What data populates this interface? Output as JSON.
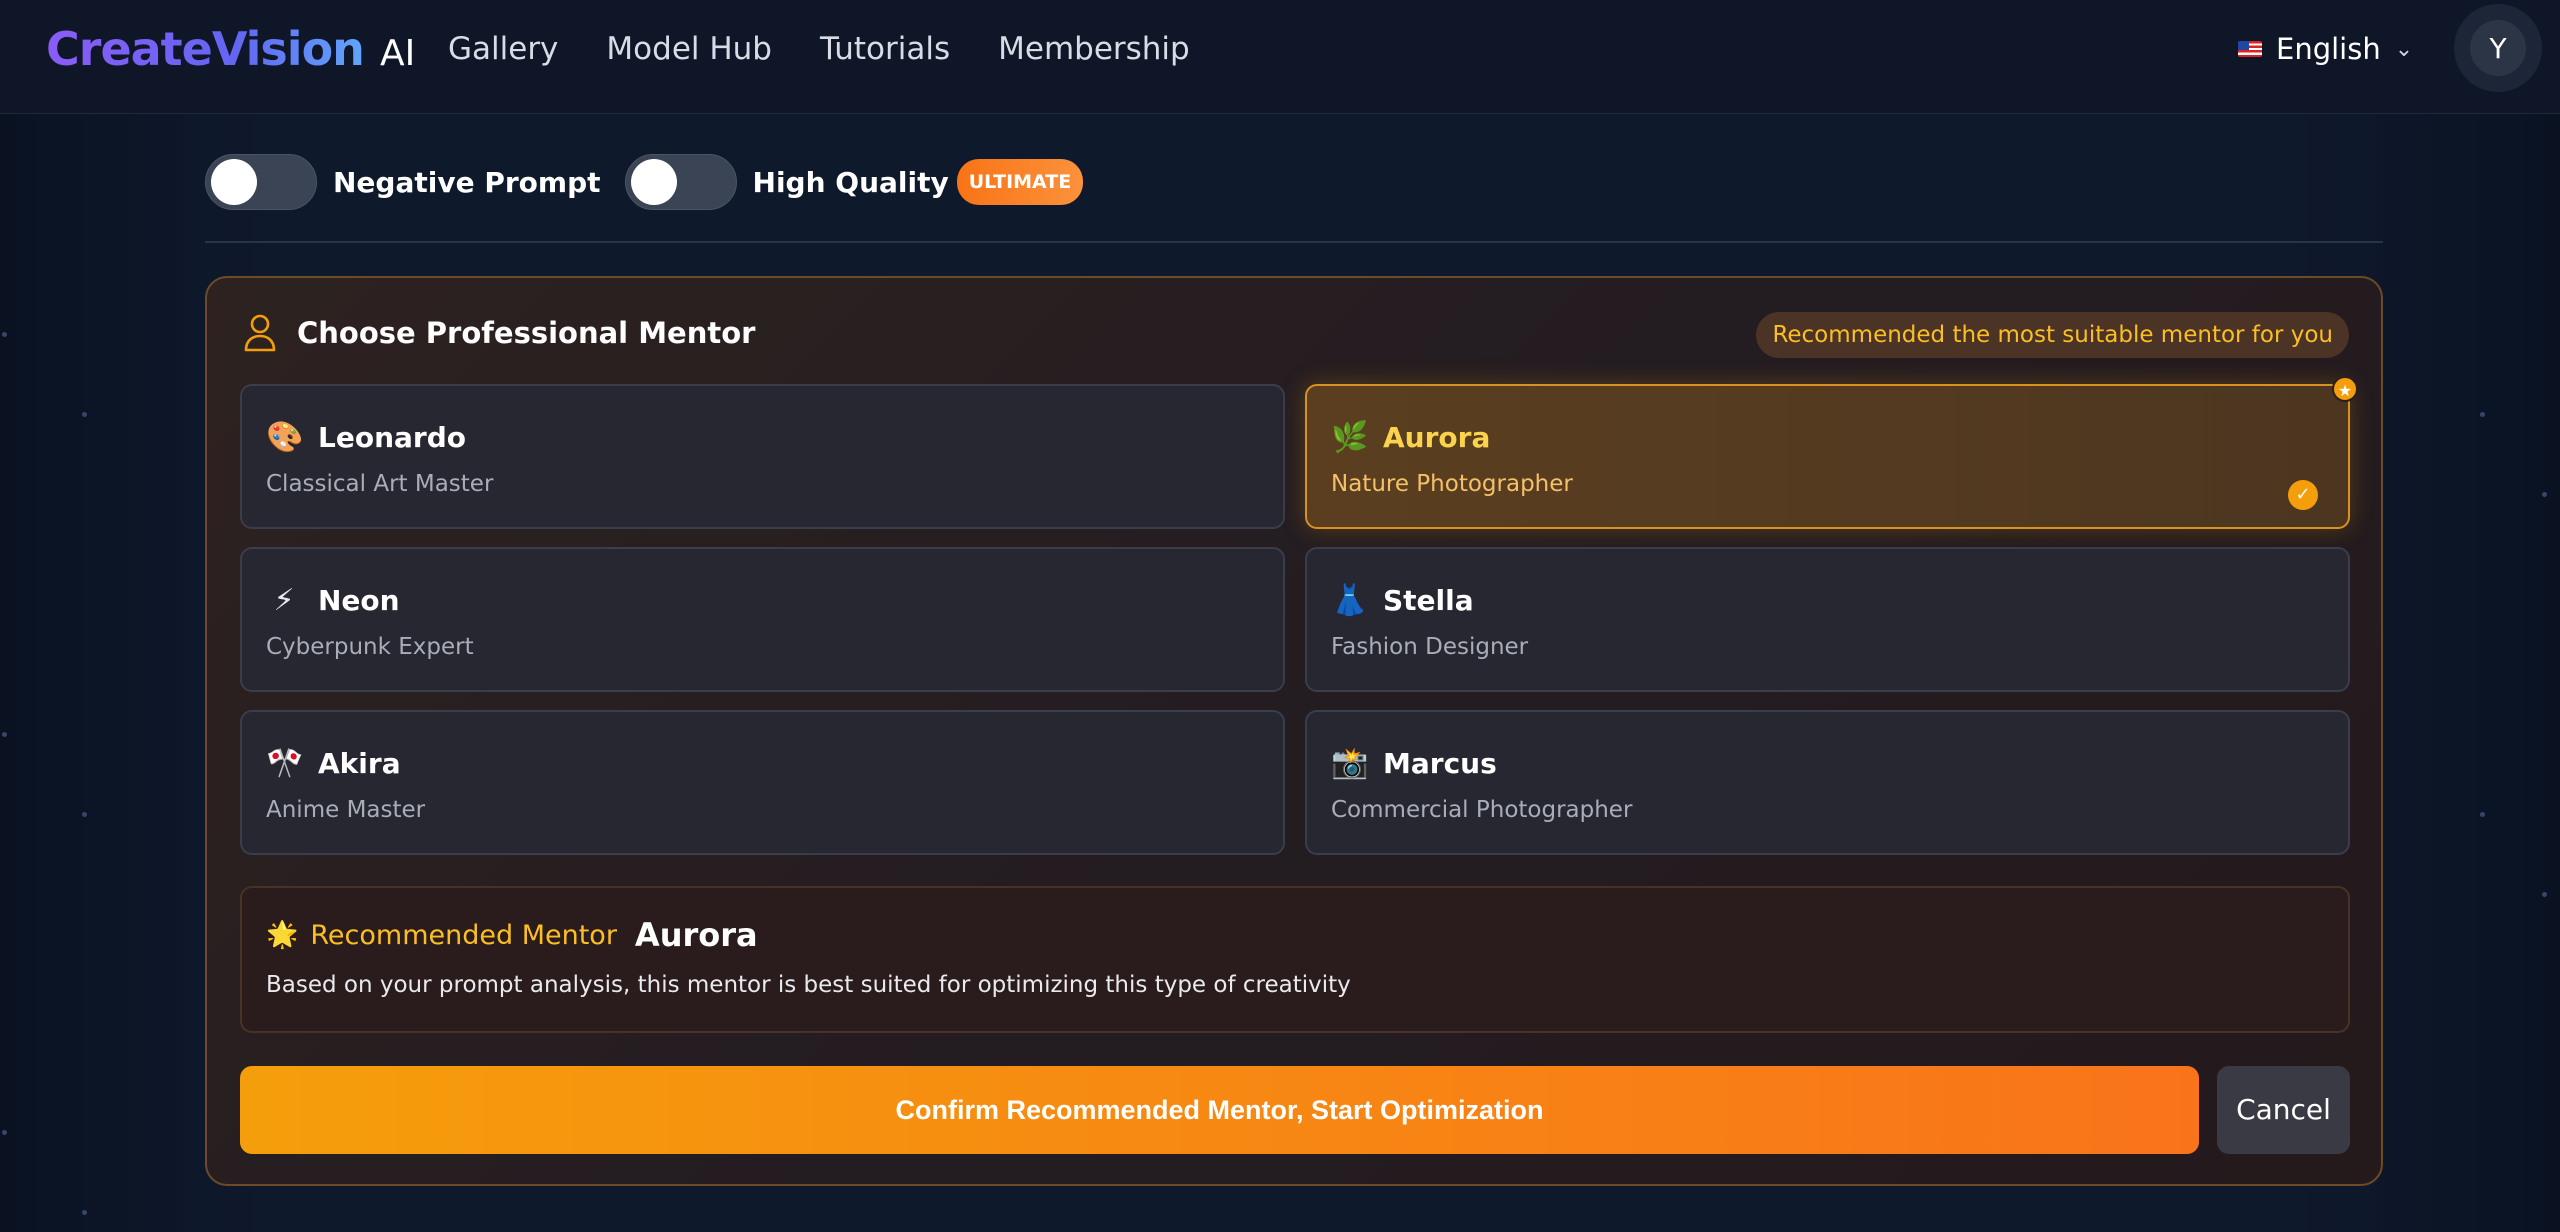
{
  "header": {
    "logo_main": "CreateVision",
    "logo_ai": "AI",
    "nav": [
      {
        "label": "Gallery"
      },
      {
        "label": "Model Hub"
      },
      {
        "label": "Tutorials"
      },
      {
        "label": "Membership"
      }
    ],
    "language": "English",
    "avatar_initial": "Y"
  },
  "toggles": {
    "negative_prompt": {
      "label": "Negative Prompt",
      "on": false
    },
    "high_quality": {
      "label": "High Quality",
      "on": false,
      "badge": "ULTIMATE"
    }
  },
  "mentor": {
    "title": "Choose Professional Mentor",
    "recommend_pill": "Recommended the most suitable mentor for you",
    "cards": [
      {
        "emoji": "🎨",
        "name": "Leonardo",
        "desc": "Classical Art Master",
        "selected": false
      },
      {
        "emoji": "🌿",
        "name": "Aurora",
        "desc": "Nature Photographer",
        "selected": true
      },
      {
        "emoji": "⚡",
        "name": "Neon",
        "desc": "Cyberpunk Expert",
        "selected": false
      },
      {
        "emoji": "👗",
        "name": "Stella",
        "desc": "Fashion Designer",
        "selected": false
      },
      {
        "emoji": "🎌",
        "name": "Akira",
        "desc": "Anime Master",
        "selected": false
      },
      {
        "emoji": "📸",
        "name": "Marcus",
        "desc": "Commercial Photographer",
        "selected": false
      }
    ],
    "selected_check": "✓",
    "star_badge": "★",
    "recommended": {
      "emoji": "🌟",
      "label": "Recommended Mentor",
      "name": "Aurora",
      "desc": "Based on your prompt analysis, this mentor is best suited for optimizing this type of creativity"
    },
    "confirm_label": "Confirm Recommended Mentor, Start Optimization",
    "cancel_label": "Cancel"
  },
  "colors": {
    "accent_orange": "#f59e0b",
    "logo_purple": "#8b5cf6",
    "background": "#0d1526"
  }
}
